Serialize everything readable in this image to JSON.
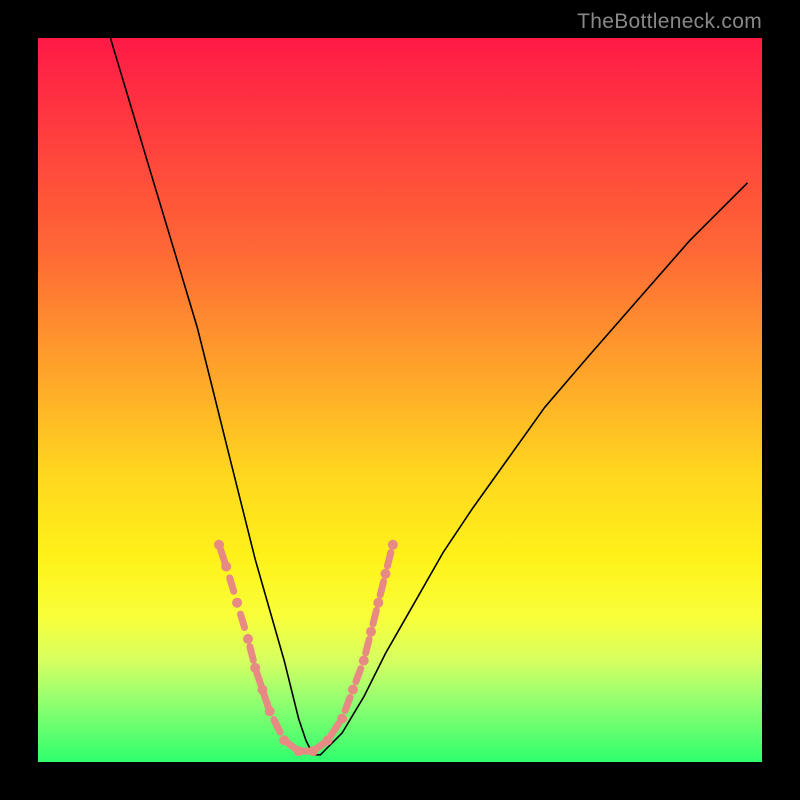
{
  "watermark": "TheBottleneck.com",
  "chart_data": {
    "type": "line",
    "title": "",
    "xlabel": "",
    "ylabel": "",
    "xlim": [
      0,
      100
    ],
    "ylim": [
      0,
      100
    ],
    "grid": false,
    "legend": false,
    "series": [
      {
        "name": "bottleneck-curve",
        "x": [
          10,
          13,
          16,
          19,
          22,
          24,
          26,
          28,
          30,
          32,
          34,
          35,
          36,
          37,
          38,
          39,
          40,
          42,
          45,
          48,
          52,
          56,
          60,
          65,
          70,
          76,
          83,
          90,
          98
        ],
        "y": [
          100,
          90,
          80,
          70,
          60,
          52,
          44,
          36,
          28,
          21,
          14,
          10,
          6,
          3,
          1,
          1,
          2,
          4,
          9,
          15,
          22,
          29,
          35,
          42,
          49,
          56,
          64,
          72,
          80
        ],
        "note": "Approximate V-shaped bottleneck curve; values read from gradient position (0=bottom/green, 100=top/red)."
      }
    ],
    "highlights": {
      "note": "Pink dotted/segmented overlay near the trough of the curve, roughly x in [24,48], y in [2,30].",
      "points": [
        {
          "x": 25,
          "y": 30
        },
        {
          "x": 26,
          "y": 27
        },
        {
          "x": 27.5,
          "y": 22
        },
        {
          "x": 29,
          "y": 17
        },
        {
          "x": 30,
          "y": 13
        },
        {
          "x": 31,
          "y": 10
        },
        {
          "x": 32,
          "y": 7
        },
        {
          "x": 34,
          "y": 3
        },
        {
          "x": 36,
          "y": 1.5
        },
        {
          "x": 38,
          "y": 1.5
        },
        {
          "x": 40,
          "y": 3
        },
        {
          "x": 42,
          "y": 6
        },
        {
          "x": 43.5,
          "y": 10
        },
        {
          "x": 45,
          "y": 14
        },
        {
          "x": 46,
          "y": 18
        },
        {
          "x": 47,
          "y": 22
        },
        {
          "x": 48,
          "y": 26
        },
        {
          "x": 49,
          "y": 30
        }
      ]
    },
    "colors": {
      "gradient_top": "#ff1a46",
      "gradient_mid": "#ffd61f",
      "gradient_bottom": "#2fff6e",
      "curve": "#000000",
      "highlight": "#e88a84",
      "frame": "#000000"
    }
  }
}
